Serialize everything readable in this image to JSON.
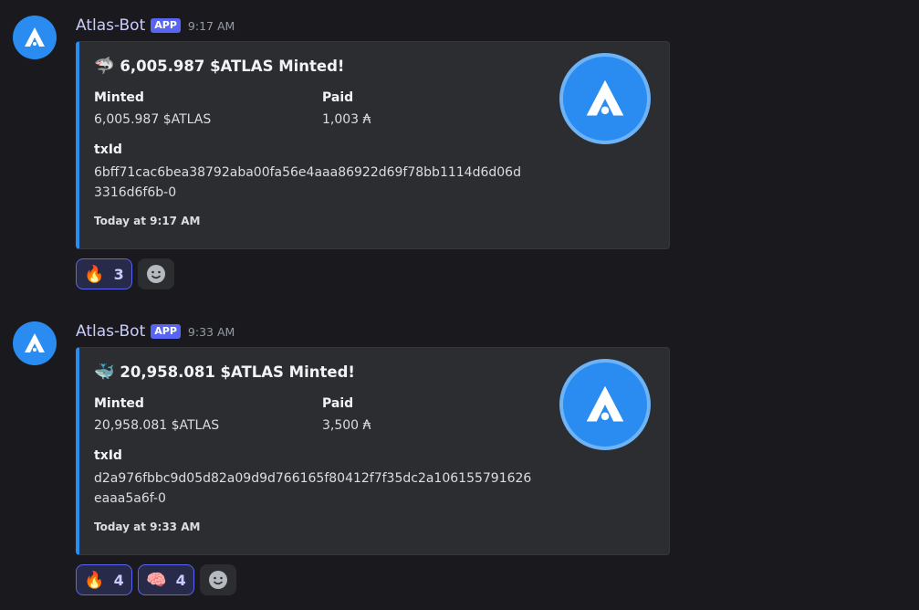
{
  "messages": [
    {
      "username": "Atlas-Bot",
      "badge": "APP",
      "time": "9:17 AM",
      "embed": {
        "emoji": "🦈",
        "title": "6,005.987 $ATLAS Minted!",
        "fields": [
          {
            "name": "Minted",
            "value": "6,005.987 $ATLAS"
          },
          {
            "name": "Paid",
            "value": "1,003 ₳"
          }
        ],
        "txid_label": "txId",
        "txid_line1": "6bff71cac6bea38792aba00fa56e4aaa86922d69f78bb1114d6d06d",
        "txid_line2": "3316d6f6b-0",
        "footer": "Today at 9:17 AM"
      },
      "reactions": [
        {
          "emoji": "🔥",
          "count": "3"
        }
      ]
    },
    {
      "username": "Atlas-Bot",
      "badge": "APP",
      "time": "9:33 AM",
      "embed": {
        "emoji": "🐳",
        "title": "20,958.081 $ATLAS Minted!",
        "fields": [
          {
            "name": "Minted",
            "value": "20,958.081 $ATLAS"
          },
          {
            "name": "Paid",
            "value": "3,500 ₳"
          }
        ],
        "txid_label": "txId",
        "txid_line1": "d2a976fbbc9d05d82a09d9d766165f80412f7f35dc2a106155791626",
        "txid_line2": "eaaa5a6f-0",
        "footer": "Today at 9:33 AM"
      },
      "reactions": [
        {
          "emoji": "🔥",
          "count": "4"
        },
        {
          "emoji": "🧠",
          "count": "4"
        }
      ]
    }
  ],
  "colors": {
    "accent": "#2a8cf1",
    "background": "#1a1a1e",
    "embed_bg": "#2b2d31",
    "badge": "#5865f2"
  },
  "icons": {
    "avatar": "atlas-logo-icon",
    "add_reaction": "smiley-icon"
  }
}
